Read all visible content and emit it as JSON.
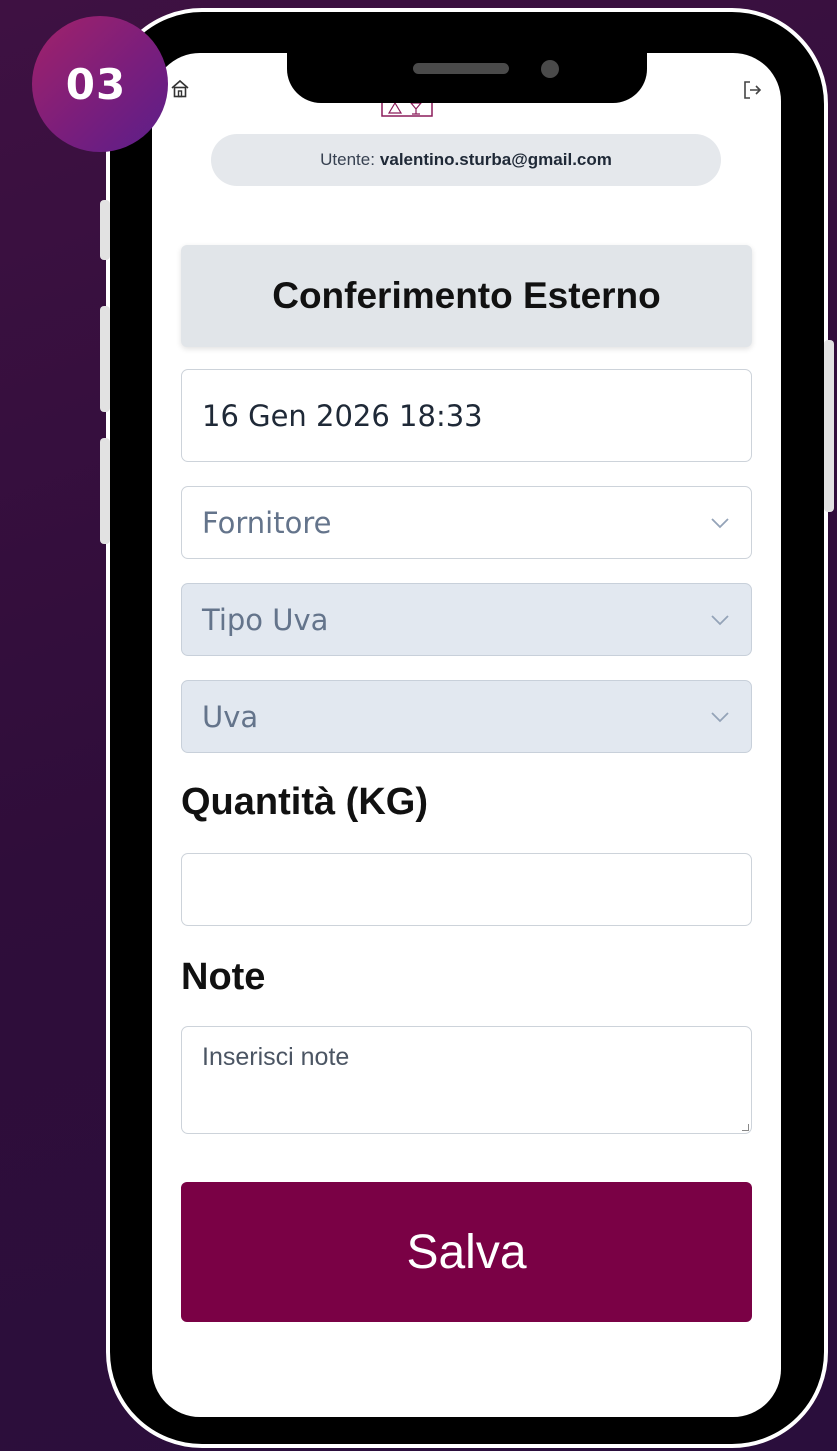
{
  "step_badge": "03",
  "header": {
    "home_icon": "home-icon",
    "logout_icon": "logout-icon",
    "logo_icon": "winery-logo"
  },
  "user": {
    "label": "Utente:",
    "email": "valentino.sturba@gmail.com"
  },
  "form": {
    "title": "Conferimento Esterno",
    "datetime_value": "16 Gen 2026 18:33",
    "fornitore_placeholder": "Fornitore",
    "tipo_uva_placeholder": "Tipo Uva",
    "uva_placeholder": "Uva",
    "quantity_label": "Quantità (KG)",
    "quantity_value": "",
    "notes_label": "Note",
    "notes_placeholder": "Inserisci note",
    "save_label": "Salva"
  },
  "colors": {
    "background": "#3e1142",
    "badge": "#a2226a",
    "save_button": "#7a0145",
    "disabled_select": "#e2e8f0",
    "title_card": "#e1e5e9"
  }
}
